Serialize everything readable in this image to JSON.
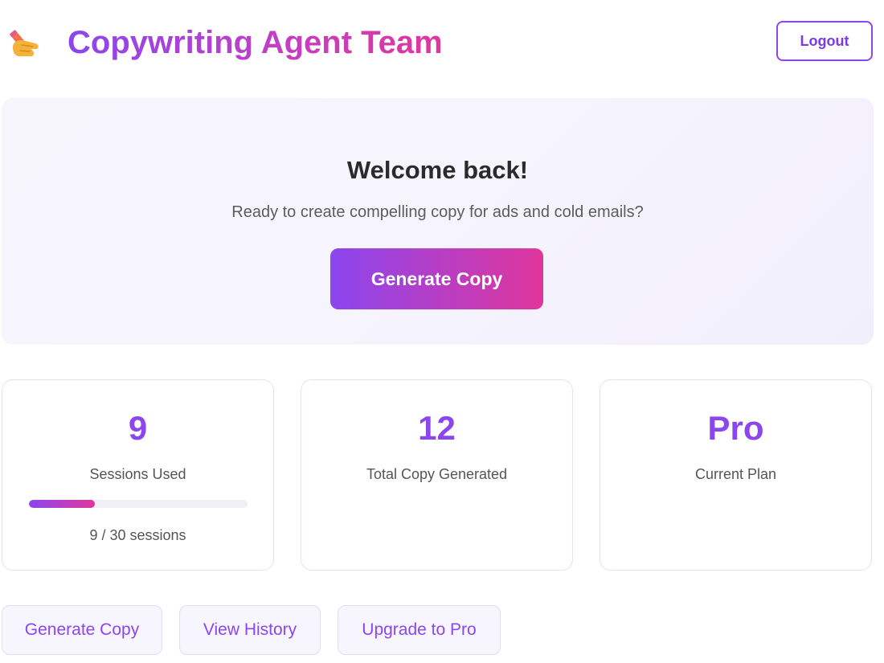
{
  "header": {
    "logo_icon": "writing-hand-icon",
    "title": "Copywriting Agent Team",
    "logout_label": "Logout"
  },
  "hero": {
    "title": "Welcome back!",
    "subtitle": "Ready to create compelling copy for ads and cold emails?",
    "cta_label": "Generate Copy"
  },
  "stats": {
    "sessions": {
      "value": "9",
      "label": "Sessions Used",
      "used": 9,
      "limit": 30,
      "progress_text": "9 / 30 sessions"
    },
    "copy": {
      "value": "12",
      "label": "Total Copy Generated"
    },
    "plan": {
      "value": "Pro",
      "label": "Current Plan"
    }
  },
  "actions": {
    "generate_label": "Generate Copy",
    "history_label": "View History",
    "upgrade_label": "Upgrade to Pro"
  },
  "colors": {
    "accent": "#8b46ee",
    "accent_end": "#e0369c"
  }
}
